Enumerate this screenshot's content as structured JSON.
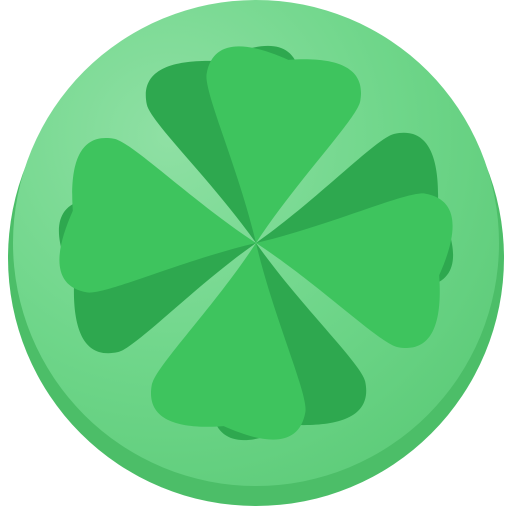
{
  "icon": {
    "name": "clover-icon",
    "colors": {
      "disc_highlight": "#8fe0a4",
      "disc_face": "#6fd68a",
      "disc_face_edge": "#5ccb78",
      "disc_rim": "#4cbe68",
      "leaf_back": "#2ea84f",
      "leaf_front": "#3ec45e"
    }
  }
}
